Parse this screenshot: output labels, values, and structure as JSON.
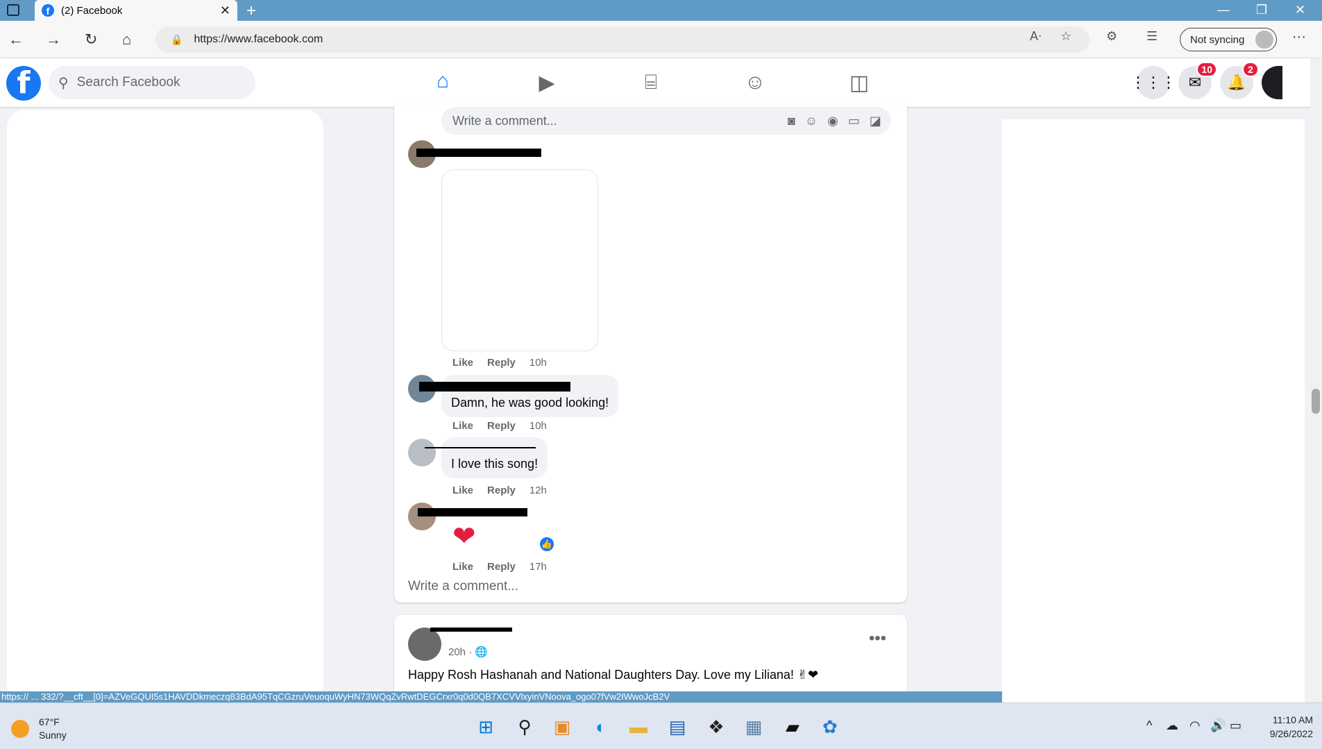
{
  "browser": {
    "tab_title": "(2) Facebook",
    "tab_close": "✕",
    "new_tab": "+",
    "url": "https://www.facebook.com",
    "sync_label": "Not syncing"
  },
  "fb": {
    "logo": "f",
    "search_placeholder": "Search Facebook",
    "messenger_badge": "10",
    "notifications_badge": "2"
  },
  "feed": {
    "comment_placeholder": "Write a comment...",
    "comments": [
      {
        "text": "",
        "like": "Like",
        "reply": "Reply",
        "time": "10h"
      },
      {
        "text": "Damn, he was good looking!",
        "like": "Like",
        "reply": "Reply",
        "time": "10h"
      },
      {
        "text": "I love this song!",
        "like": "Like",
        "reply": "Reply",
        "time": "12h"
      },
      {
        "text": "❤",
        "like": "Like",
        "reply": "Reply",
        "time": "17h"
      }
    ],
    "write_comment": "Write a comment...",
    "next_post": {
      "time": "20h",
      "privacy": "· 🌐",
      "text": "Happy Rosh Hashanah and National Daughters Day. Love my Liliana! ✌❤"
    }
  },
  "status_link": "https:// ... 332/?__cft__[0]=AZVeGQUI5s1HAVDDkmeczq83BdA95TqCGzruVeuoquWyHN73WQqZvRwtDEGCrxr0q0d0QB7XCVVlxyinVNoova_ogo07fVw2IWwoJcB2V",
  "taskbar": {
    "temp": "67°F",
    "condition": "Sunny",
    "time": "11:10 AM",
    "date": "9/26/2022"
  },
  "colors": {
    "fb_blue": "#1877f2",
    "badge_red": "#e41e3f",
    "titlebar": "#5f9bc4"
  }
}
